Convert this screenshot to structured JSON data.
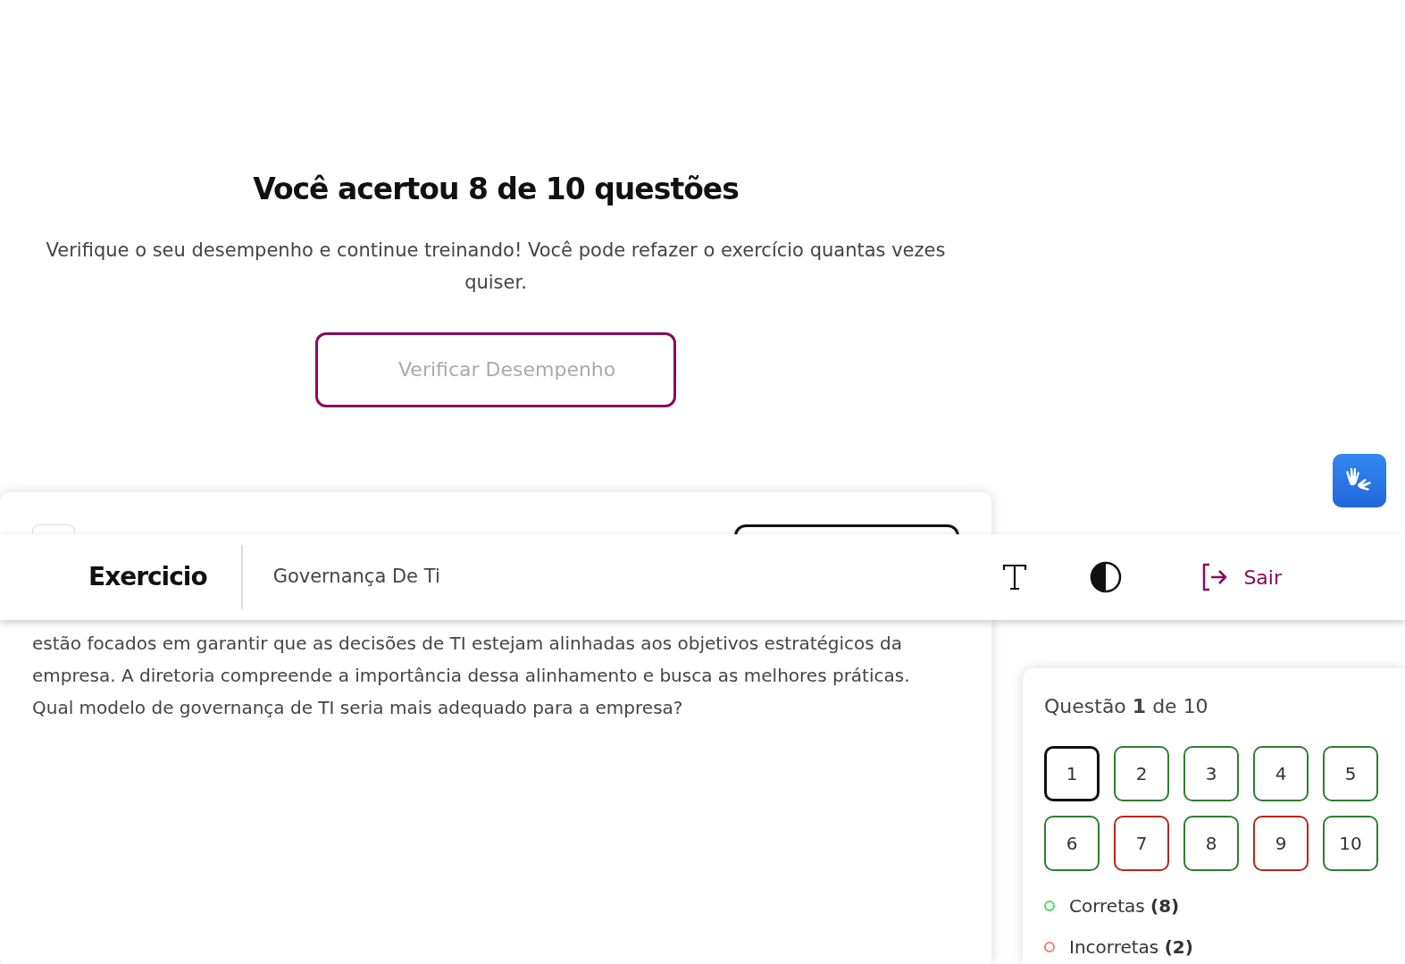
{
  "result": {
    "title": "Você acertou 8 de 10 questões",
    "subtitle": "Verifique o seu desempenho e continue treinando! Você pode refazer o exercício quantas vezes quiser.",
    "button": "Verificar Desempenho"
  },
  "navbar": {
    "brand": "Exercicio",
    "subject": "Governança De Ti",
    "exit": "Sair"
  },
  "question": {
    "text_lines": [
      "estão focados em garantir que as decisões de TI estejam alinhadas aos objetivos estratégicos da empresa. A diretoria compreende a importância dessa alinhamento e busca as melhores práticas."
    ],
    "prompt": "Qual modelo de governança de TI seria mais adequado para a empresa?"
  },
  "panel": {
    "heading": "Questão **1** de 10",
    "questions": [
      {
        "label": "1",
        "kind": "correct",
        "selected": true
      },
      {
        "label": "2",
        "kind": "correct",
        "selected": false
      },
      {
        "label": "3",
        "kind": "correct",
        "selected": false
      },
      {
        "label": "4",
        "kind": "correct",
        "selected": false
      },
      {
        "label": "5",
        "kind": "correct",
        "selected": false
      },
      {
        "label": "6",
        "kind": "correct",
        "selected": false
      },
      {
        "label": "7",
        "kind": "incorrect",
        "selected": false
      },
      {
        "label": "8",
        "kind": "correct",
        "selected": false
      },
      {
        "label": "9",
        "kind": "incorrect",
        "selected": false
      },
      {
        "label": "10",
        "kind": "correct",
        "selected": false
      }
    ],
    "legend": [
      {
        "text": "Corretas **(8)**",
        "color": "#4cd964"
      },
      {
        "text": "Incorretas **(2)**",
        "color": "#f0806a"
      }
    ]
  }
}
